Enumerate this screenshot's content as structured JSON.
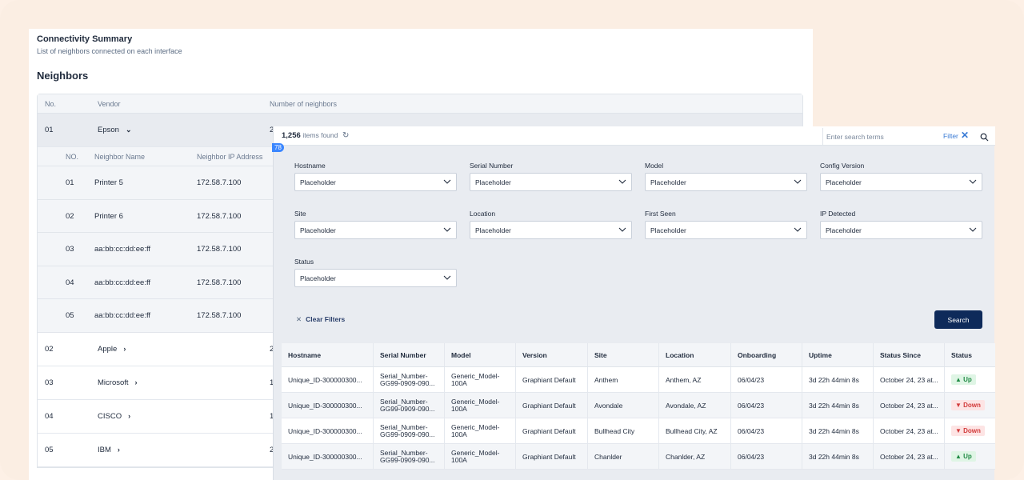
{
  "summary": {
    "title": "Connectivity Summary",
    "subtitle": "List of neighbors connected on each interface",
    "neighbors_heading": "Neighbors"
  },
  "neighbors_table": {
    "headers": [
      "No.",
      "Vendor",
      "Number of neighbors"
    ],
    "rows": [
      {
        "no": "01",
        "vendor": "Epson",
        "count": "2"
      },
      {
        "no": "02",
        "vendor": "Apple",
        "count": "2"
      },
      {
        "no": "03",
        "vendor": "Microsoft",
        "count": "1!"
      },
      {
        "no": "04",
        "vendor": "CISCO",
        "count": "1:"
      },
      {
        "no": "05",
        "vendor": "IBM",
        "count": "2"
      }
    ],
    "sub_headers": [
      "NO.",
      "Neighbor Name",
      "Neighbor IP Address"
    ],
    "sub_rows": [
      {
        "no": "01",
        "name": "Printer 5",
        "ip": "172.58.7.100"
      },
      {
        "no": "02",
        "name": "Printer 6",
        "ip": "172.58.7.100"
      },
      {
        "no": "03",
        "name": "aa:bb:cc:dd:ee:ff",
        "ip": "172.58.7.100"
      },
      {
        "no": "04",
        "name": "aa:bb:cc:dd:ee:ff",
        "ip": "172.58.7.100"
      },
      {
        "no": "05",
        "name": "aa:bb:cc:dd:ee:ff",
        "ip": "172.58.7.100"
      }
    ]
  },
  "inventory": {
    "count": "1,256",
    "count_suffix": "items found",
    "badge": "78",
    "search_placeholder": "Enter search terms",
    "filter_label": "Filter",
    "filters": [
      {
        "label": "Hostname",
        "value": "Placeholder"
      },
      {
        "label": "Serial Number",
        "value": "Placeholder"
      },
      {
        "label": "Model",
        "value": "Placeholder"
      },
      {
        "label": "Config Version",
        "value": "Placeholder"
      },
      {
        "label": "Site",
        "value": "Placeholder"
      },
      {
        "label": "Location",
        "value": "Placeholder"
      },
      {
        "label": "First Seen",
        "value": "Placeholder"
      },
      {
        "label": "IP Detected",
        "value": "Placeholder"
      },
      {
        "label": "Status",
        "value": "Placeholder"
      }
    ],
    "clear_filters": "Clear Filters",
    "search_button": "Search",
    "columns": [
      "Hostname",
      "Serial Number",
      "Model",
      "Version",
      "Site",
      "Location",
      "Onboarding",
      "Uptime",
      "Status Since",
      "Status"
    ],
    "rows": [
      {
        "hostname": "Unique_ID-300000300...",
        "serial": "Serial_Number-GG99-0909-090...",
        "model": "Generic_Model-100A",
        "version": "Graphiant Default",
        "site": "Anthem",
        "location": "Anthem, AZ",
        "onboarding": "06/04/23",
        "uptime": "3d 22h 44min 8s",
        "since": "October 24, 23 at...",
        "status": "Up"
      },
      {
        "hostname": "Unique_ID-300000300...",
        "serial": "Serial_Number-GG99-0909-090...",
        "model": "Generic_Model-100A",
        "version": "Graphiant Default",
        "site": "Avondale",
        "location": "Avondale, AZ",
        "onboarding": "06/04/23",
        "uptime": "3d 22h 44min 8s",
        "since": "October 24, 23 at...",
        "status": "Down"
      },
      {
        "hostname": "Unique_ID-300000300...",
        "serial": "Serial_Number-GG99-0909-090...",
        "model": "Generic_Model-100A",
        "version": "Graphiant Default",
        "site": "Bullhead City",
        "location": "Bullhead City, AZ",
        "onboarding": "06/04/23",
        "uptime": "3d 22h 44min 8s",
        "since": "October 24, 23 at...",
        "status": "Down"
      },
      {
        "hostname": "Unique_ID-300000300...",
        "serial": "Serial_Number-GG99-0909-090...",
        "model": "Generic_Model-100A",
        "version": "Graphiant Default",
        "site": "Chanlder",
        "location": "Chanlder, AZ",
        "onboarding": "06/04/23",
        "uptime": "3d 22h 44min 8s",
        "since": "October 24, 23 at...",
        "status": "Up"
      }
    ],
    "colors": {
      "up_bg": "#dff5e5",
      "up_fg": "#1f8a44",
      "down_bg": "#fde4e4",
      "down_fg": "#d23a3a",
      "primary": "#0e2a5a"
    }
  }
}
